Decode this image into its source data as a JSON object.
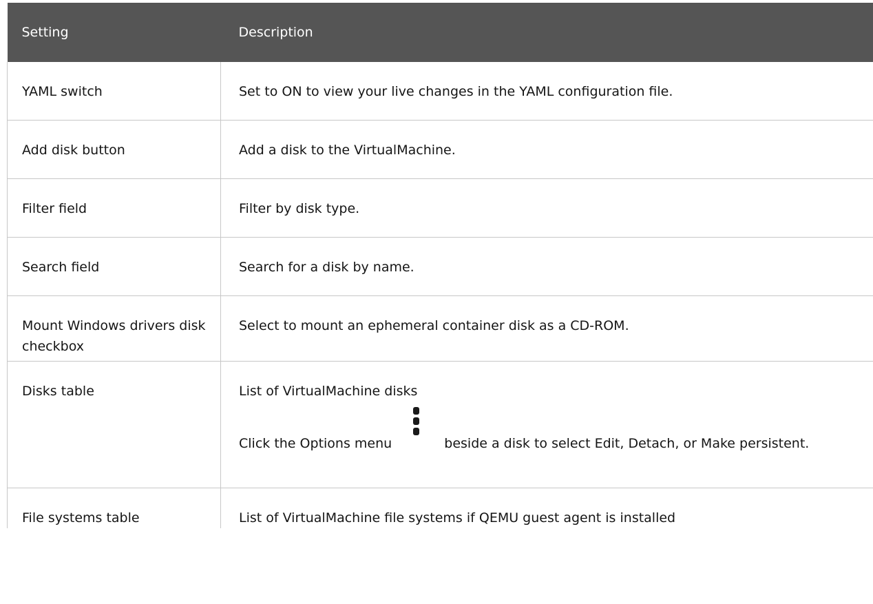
{
  "headers": {
    "setting": "Setting",
    "description": "Description"
  },
  "rows": [
    {
      "term": "YAML",
      "suffix": " switch",
      "desc_pre": "Set to ",
      "desc_bold": "ON",
      "desc_post": " to view your live changes in the YAML configuration file."
    },
    {
      "term": "Add disk",
      "suffix": " button",
      "desc": "Add a disk to the VirtualMachine."
    },
    {
      "term": "Filter",
      "suffix": " field",
      "desc": "Filter by disk type."
    },
    {
      "term": "",
      "suffix": "Search field",
      "desc": "Search for a disk by name."
    },
    {
      "term": "Mount Windows drivers disk",
      "suffix": " checkbox",
      "desc": "Select to mount an ephemeral container disk as a CD-ROM."
    },
    {
      "term": "Disks",
      "suffix": " table",
      "desc": "List of VirtualMachine disks",
      "p2": {
        "t1": "Click the ",
        "b1": "Options",
        "t2": " menu ",
        "icon": "kebab-menu-icon",
        "t3": " beside a disk to select ",
        "b2": "Edit",
        "t4": ", ",
        "b3": "Detach",
        "t5": ", or ",
        "b4": "Make persistent",
        "t6": "."
      }
    },
    {
      "term": "File systems",
      "suffix": " table",
      "desc": "List of VirtualMachine file systems if QEMU guest agent is installed"
    }
  ]
}
